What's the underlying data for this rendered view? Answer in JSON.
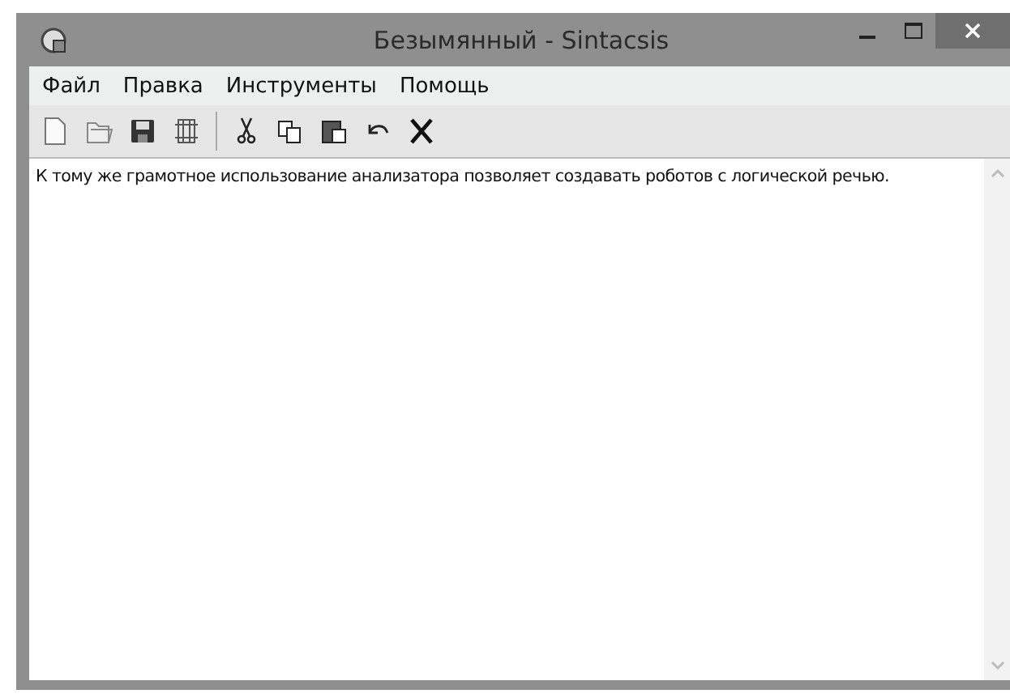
{
  "window": {
    "title": "Безымянный - Sintacsis"
  },
  "menu": [
    "Файл",
    "Правка",
    "Инструменты",
    "Помощь"
  ],
  "editor": {
    "text": "К тому же грамотное использование анализатора позволяет создавать роботов с логической речью."
  }
}
